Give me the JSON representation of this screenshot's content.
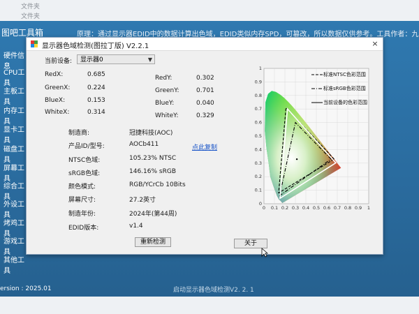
{
  "background": {
    "top_items": [
      "文件夹",
      "文件夹"
    ],
    "app_title": "图吧工具箱",
    "notice": "原理：通过显示器EDID中的数据计算出色域，EDID类似内存SPD，可篡改，所以数据仅供参考。工具作者：九图根幅",
    "sidebar": [
      "硬件信息",
      "CPU工具",
      "主板工具",
      "内存工具",
      "显卡工具",
      "磁盘工具",
      "屏幕工具",
      "综合工具",
      "外设工具",
      "烤鸡工具",
      "游戏工具",
      "其他工具"
    ],
    "version": "ersion : 2025.01",
    "status": "启动显示器色域检测V2. 2. 1"
  },
  "dialog": {
    "title": "显示器色域检测(图拉丁版) V2.2.1",
    "close": "×",
    "monitor_label": "当前设备:",
    "monitor_value": "显示器0",
    "coords": [
      {
        "label": "RedX:",
        "value": "0.685"
      },
      {
        "label": "RedY:",
        "value": "0.302"
      },
      {
        "label": "GreenX:",
        "value": "0.224"
      },
      {
        "label": "GreenY:",
        "value": "0.701"
      },
      {
        "label": "BlueX:",
        "value": "0.153"
      },
      {
        "label": "BlueY:",
        "value": "0.040"
      },
      {
        "label": "WhiteX:",
        "value": "0.314"
      },
      {
        "label": "WhiteY:",
        "value": "0.329"
      }
    ],
    "info": [
      {
        "label": "制造商:",
        "value": "冠捷科技(AOC)"
      },
      {
        "label": "产品ID/型号:",
        "value": "AOCb411"
      },
      {
        "label": "NTSC色域:",
        "value": "105.23% NTSC"
      },
      {
        "label": "sRGB色域:",
        "value": "146.16% sRGB"
      },
      {
        "label": "颜色模式:",
        "value": "RGB/YCrCb 10Bits"
      },
      {
        "label": "屏幕尺寸:",
        "value": "27.2英寸"
      },
      {
        "label": "制造年份:",
        "value": "2024年(第44周)"
      },
      {
        "label": "EDID版本:",
        "value": "v1.4"
      }
    ],
    "copy_link": "点此复制",
    "recheck_button": "重新检测",
    "about_button": "关于"
  },
  "chart_data": {
    "type": "scatter",
    "xlim": [
      0,
      1
    ],
    "ylim": [
      0,
      1
    ],
    "x_ticks": [
      "0",
      "0.1",
      "0.2",
      "0.3",
      "0.4",
      "0.5",
      "0.6",
      "0.7",
      "0.8",
      "0.9",
      "1"
    ],
    "y_ticks": [
      "0",
      "0.1",
      "0.2",
      "0.3",
      "0.4",
      "0.5",
      "0.6",
      "0.7",
      "0.8",
      "0.9",
      "1"
    ],
    "grid": true,
    "legend_position": "top-right",
    "series": [
      {
        "name": "标准NTSC色彩范围",
        "style": "dashed",
        "color": "#000000",
        "points": [
          [
            0.67,
            0.33
          ],
          [
            0.21,
            0.71
          ],
          [
            0.14,
            0.08
          ]
        ]
      },
      {
        "name": "标准sRGB色彩范围",
        "style": "dashdot",
        "color": "#000000",
        "points": [
          [
            0.64,
            0.33
          ],
          [
            0.3,
            0.6
          ],
          [
            0.15,
            0.06
          ]
        ]
      },
      {
        "name": "当前设备的色彩范围",
        "style": "solid",
        "color": "#ffffff",
        "points": [
          [
            0.685,
            0.302
          ],
          [
            0.224,
            0.701
          ],
          [
            0.153,
            0.04
          ]
        ]
      }
    ],
    "white_point": [
      0.314,
      0.329
    ]
  }
}
